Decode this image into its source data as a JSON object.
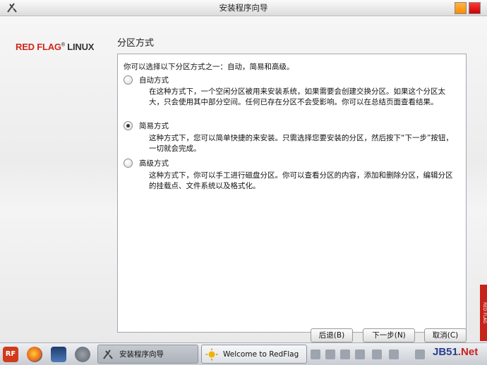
{
  "window": {
    "title": "安装程序向导",
    "app_icon": "wizard-icon",
    "min_color": "#ff8c00",
    "close_color": "#c80000"
  },
  "logo": {
    "text_red": "RED FLAG",
    "reg": "®",
    "text_dark": " LINUX"
  },
  "section_title": "分区方式",
  "intro": "你可以选择以下分区方式之一：自动，简易和高级。",
  "options": [
    {
      "label": "自动方式",
      "checked": false,
      "description": "在这种方式下，一个空闲分区被用来安装系统，如果需要会创建交换分区。如果这个分区太大，只会使用其中部分空间。任何已存在分区不会受影响。你可以在总结页面查看结果。"
    },
    {
      "label": "简易方式",
      "checked": true,
      "description": "这种方式下，您可以简单快捷的来安装。只需选择您要安装的分区，然后按下“下一步”按钮，一切就会完成。"
    },
    {
      "label": "高级方式",
      "checked": false,
      "description": "这种方式下，你可以手工进行磁盘分区。你可以查看分区的内容，添加和删除分区，编辑分区的挂载点、文件系统以及格式化。"
    }
  ],
  "buttons": {
    "back": "后退(B)",
    "next": "下一步(N)",
    "cancel": "取消(C)"
  },
  "taskbar": {
    "start_label": "RF",
    "tasks": [
      {
        "label": "安装程序向导",
        "icon": "wizard-icon",
        "active": true
      },
      {
        "label": "Welcome to RedFlag",
        "icon": "sun-icon",
        "active": false
      }
    ],
    "watermark": {
      "main": "JB51",
      "tail": ".Net"
    },
    "side_tab": "RED FLAG"
  }
}
